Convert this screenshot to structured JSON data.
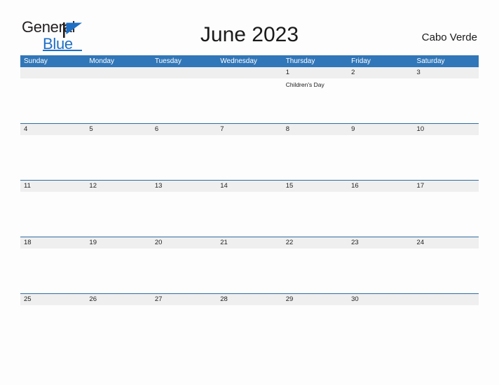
{
  "logo": {
    "line1": "General",
    "line2": "Blue",
    "flag_icon": "blue-flag-icon",
    "text_color": "#231f20",
    "accent_color": "#1f6fc4"
  },
  "header": {
    "title": "June 2023",
    "region": "Cabo Verde"
  },
  "calendar": {
    "header_bg": "#3176b8",
    "band_bg": "#efefef",
    "row_border": "#2e6da4",
    "weekdays": [
      "Sunday",
      "Monday",
      "Tuesday",
      "Wednesday",
      "Thursday",
      "Friday",
      "Saturday"
    ],
    "weeks": [
      [
        {
          "date": "",
          "events": []
        },
        {
          "date": "",
          "events": []
        },
        {
          "date": "",
          "events": []
        },
        {
          "date": "",
          "events": []
        },
        {
          "date": "1",
          "events": [
            "Children's Day"
          ]
        },
        {
          "date": "2",
          "events": []
        },
        {
          "date": "3",
          "events": []
        }
      ],
      [
        {
          "date": "4",
          "events": []
        },
        {
          "date": "5",
          "events": []
        },
        {
          "date": "6",
          "events": []
        },
        {
          "date": "7",
          "events": []
        },
        {
          "date": "8",
          "events": []
        },
        {
          "date": "9",
          "events": []
        },
        {
          "date": "10",
          "events": []
        }
      ],
      [
        {
          "date": "11",
          "events": []
        },
        {
          "date": "12",
          "events": []
        },
        {
          "date": "13",
          "events": []
        },
        {
          "date": "14",
          "events": []
        },
        {
          "date": "15",
          "events": []
        },
        {
          "date": "16",
          "events": []
        },
        {
          "date": "17",
          "events": []
        }
      ],
      [
        {
          "date": "18",
          "events": []
        },
        {
          "date": "19",
          "events": []
        },
        {
          "date": "20",
          "events": []
        },
        {
          "date": "21",
          "events": []
        },
        {
          "date": "22",
          "events": []
        },
        {
          "date": "23",
          "events": []
        },
        {
          "date": "24",
          "events": []
        }
      ],
      [
        {
          "date": "25",
          "events": []
        },
        {
          "date": "26",
          "events": []
        },
        {
          "date": "27",
          "events": []
        },
        {
          "date": "28",
          "events": []
        },
        {
          "date": "29",
          "events": []
        },
        {
          "date": "30",
          "events": []
        },
        {
          "date": "",
          "events": []
        }
      ]
    ]
  }
}
